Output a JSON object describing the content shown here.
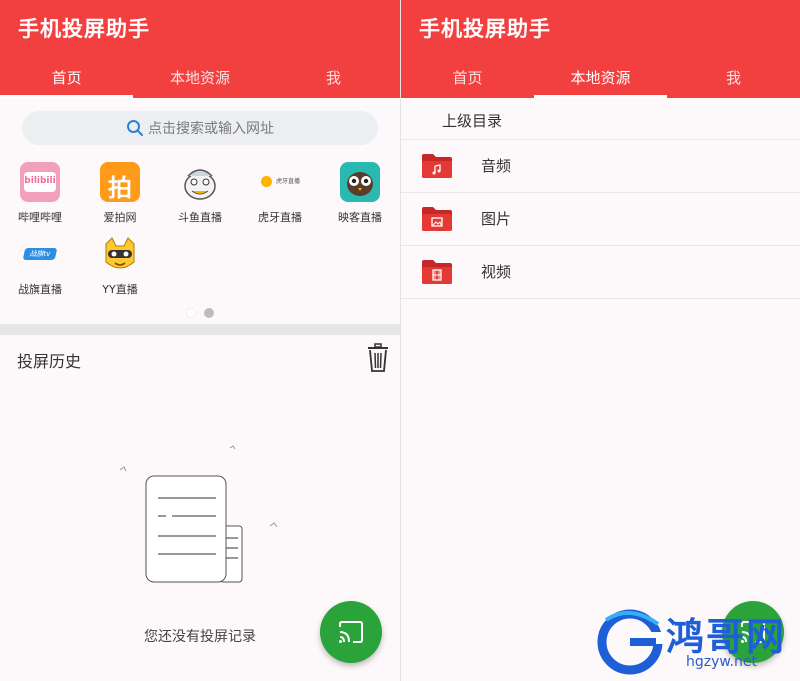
{
  "left": {
    "app_title": "手机投屏助手",
    "tabs": [
      {
        "label": "首页",
        "active": true
      },
      {
        "label": "本地资源",
        "active": false
      },
      {
        "label": "我",
        "active": false
      }
    ],
    "search_placeholder": "点击搜索或输入网址",
    "apps": [
      {
        "label": "哔哩哔哩",
        "icon": "bilibili-icon",
        "logo_text": "bilibili"
      },
      {
        "label": "爱拍网",
        "icon": "aipai-icon",
        "logo_text": "拍"
      },
      {
        "label": "斗鱼直播",
        "icon": "douyu-icon"
      },
      {
        "label": "虎牙直播",
        "icon": "huya-icon",
        "logo_text": "虎牙直播"
      },
      {
        "label": "映客直播",
        "icon": "inke-icon"
      },
      {
        "label": "战旗直播",
        "icon": "zhanqi-icon",
        "logo_text": "战旗tv"
      },
      {
        "label": "YY直播",
        "icon": "yy-icon"
      }
    ],
    "history_title": "投屏历史",
    "empty_text": "您还没有投屏记录"
  },
  "right": {
    "app_title": "手机投屏助手",
    "tabs": [
      {
        "label": "首页",
        "active": false
      },
      {
        "label": "本地资源",
        "active": true
      },
      {
        "label": "我",
        "active": false
      }
    ],
    "parent_dir": "上级目录",
    "folders": [
      {
        "label": "音频",
        "icon": "music-folder-icon"
      },
      {
        "label": "图片",
        "icon": "image-folder-icon"
      },
      {
        "label": "视频",
        "icon": "video-folder-icon"
      }
    ]
  },
  "watermark": {
    "text": "鸿哥网",
    "url": "hgzyw.net"
  },
  "colors": {
    "primary": "#f24040",
    "fab": "#2aa33a",
    "folder": "#c62828"
  }
}
